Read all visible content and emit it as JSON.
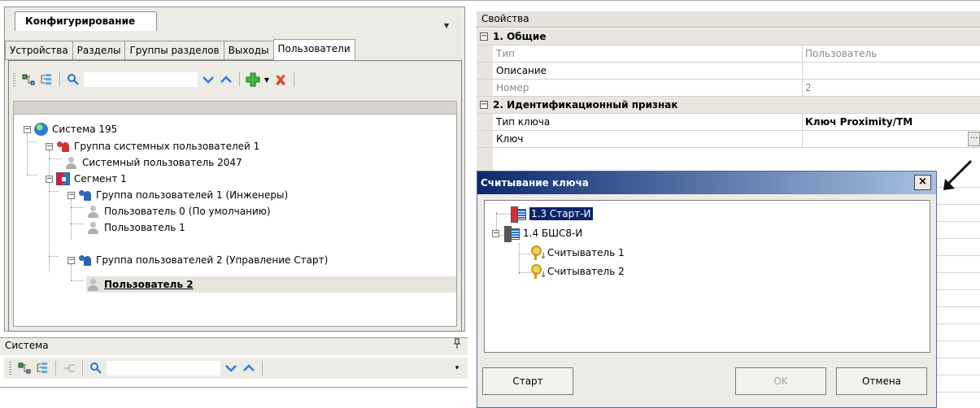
{
  "config_panel": {
    "doc_tab": "Конфигурирование",
    "tabs": [
      "Устройства",
      "Разделы",
      "Группы разделов",
      "Выходы",
      "Пользователи"
    ],
    "active_tab": "Пользователи",
    "search_placeholder": "",
    "tree": [
      {
        "label": "Система 195",
        "icon": "globe-icon"
      },
      {
        "label": "Группа системных пользователей 1",
        "icon": "user-group-red-icon"
      },
      {
        "label": "Системный пользователь 2047",
        "icon": "user-icon"
      },
      {
        "label": "Сегмент 1",
        "icon": "segment-icon"
      },
      {
        "label": "Группа пользователей 1 (Инженеры)",
        "icon": "user-group-blue-icon"
      },
      {
        "label": "Пользователь 0 (По умолчанию)",
        "icon": "user-icon"
      },
      {
        "label": "Пользователь 1",
        "icon": "user-icon"
      },
      {
        "label": "Группа пользователей 2 (Управление Старт)",
        "icon": "user-group-blue-icon"
      },
      {
        "label": "Пользователь 2",
        "icon": "user-icon",
        "selected": true
      }
    ]
  },
  "system_panel": {
    "title": "Система"
  },
  "properties": {
    "header": "Свойства",
    "categories": [
      {
        "name": "1. Общие",
        "rows": [
          {
            "key": "Тип",
            "value": "Пользователь",
            "readonly": true
          },
          {
            "key": "Описание",
            "value": "",
            "readonly": false
          },
          {
            "key": "Номер",
            "value": "2",
            "readonly": true
          }
        ]
      },
      {
        "name": "2. Идентификационный признак",
        "rows": [
          {
            "key": "Тип ключа",
            "value": "Ключ Proximity/TM",
            "readonly": false
          },
          {
            "key": "Ключ",
            "value": "",
            "readonly": false
          }
        ]
      }
    ],
    "ellipsis": "..."
  },
  "dialog": {
    "title": "Считывание ключа",
    "close": "×",
    "tree": [
      {
        "label": "1.3 Старт-И",
        "selected": true
      },
      {
        "label": "1.4 БШС8-И"
      },
      {
        "label": "Считыватель 1"
      },
      {
        "label": "Считыватель 2"
      }
    ],
    "buttons": {
      "start": "Старт",
      "ok": "OK",
      "cancel": "Отмена"
    }
  },
  "colors": {
    "dialog_title_start": "#0b2a6e",
    "selection": "#0a246a",
    "panel_bg": "#ecebe6"
  }
}
